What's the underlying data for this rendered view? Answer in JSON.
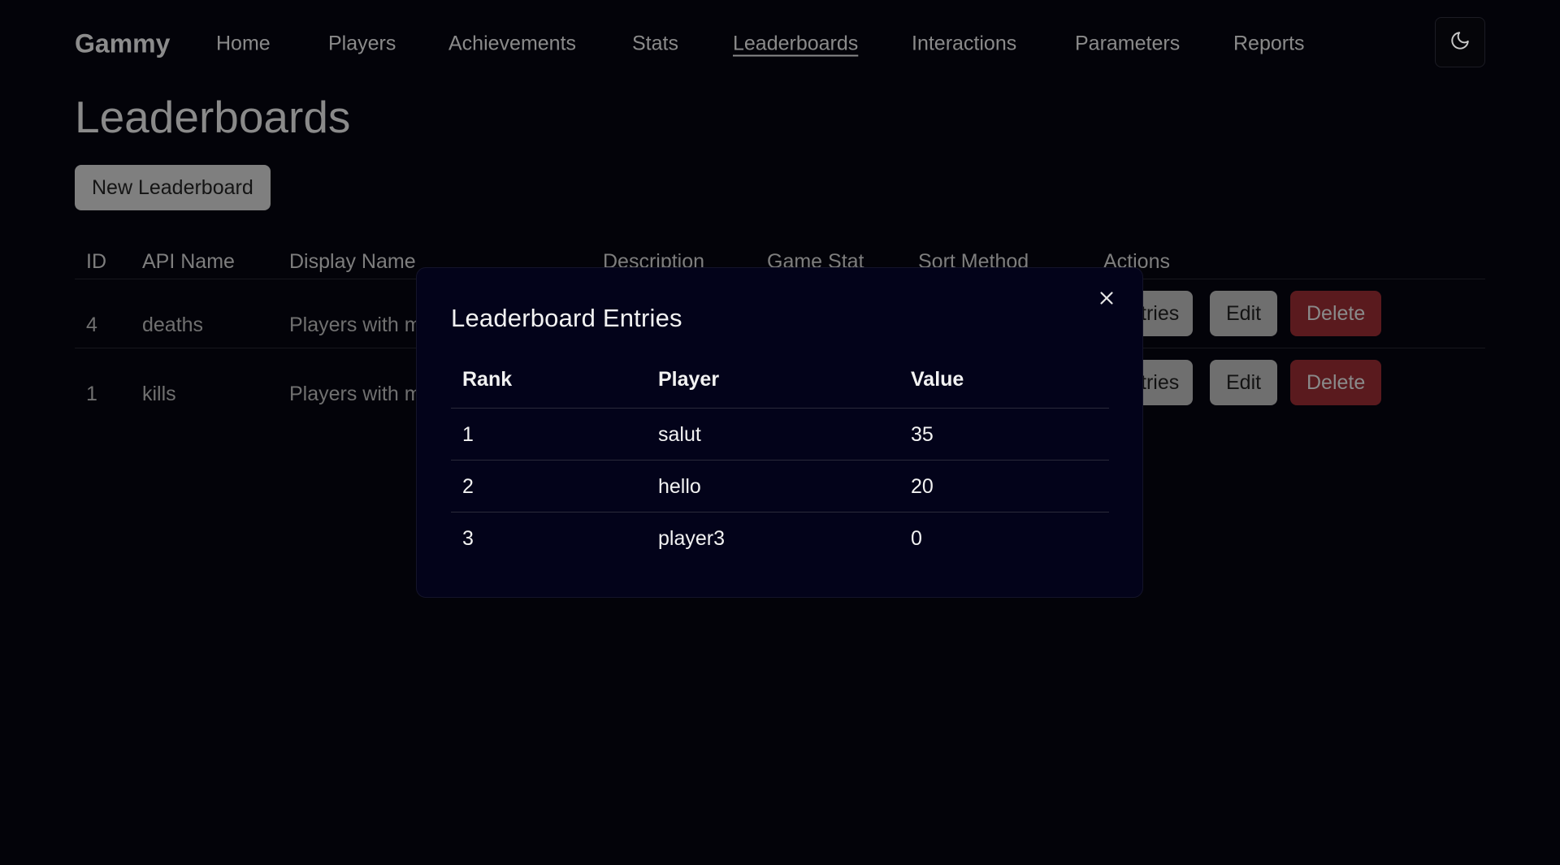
{
  "nav": {
    "brand": "Gammy",
    "links": [
      "Home",
      "Players",
      "Achievements",
      "Stats",
      "Leaderboards",
      "Interactions",
      "Parameters",
      "Reports"
    ],
    "active": "Leaderboards",
    "theme_toggle_icon": "moon-icon"
  },
  "header": {
    "title": "Leaderboards",
    "new_button_label": "New Leaderboard"
  },
  "table": {
    "columns": [
      "ID",
      "API Name",
      "Display Name",
      "Description",
      "Game Stat",
      "Sort Method",
      "Actions"
    ],
    "rows": [
      {
        "id": "4",
        "api_name": "deaths",
        "display_name_visible": "Players with m",
        "entries_label_visible": "tries",
        "edit_label": "Edit",
        "delete_label": "Delete"
      },
      {
        "id": "1",
        "api_name": "kills",
        "display_name_visible": "Players with m",
        "entries_label_visible": "tries",
        "edit_label": "Edit",
        "delete_label": "Delete"
      }
    ]
  },
  "modal": {
    "title": "Leaderboard Entries",
    "close_icon": "close-icon",
    "columns": [
      "Rank",
      "Player",
      "Value"
    ],
    "entries": [
      {
        "rank": "1",
        "player": "salut",
        "value": "35"
      },
      {
        "rank": "2",
        "player": "hello",
        "value": "20"
      },
      {
        "rank": "3",
        "player": "player3",
        "value": "0"
      }
    ]
  },
  "colors": {
    "background": "#030309",
    "modal_background": "#03031a",
    "delete_button": "#5a1a1e"
  }
}
